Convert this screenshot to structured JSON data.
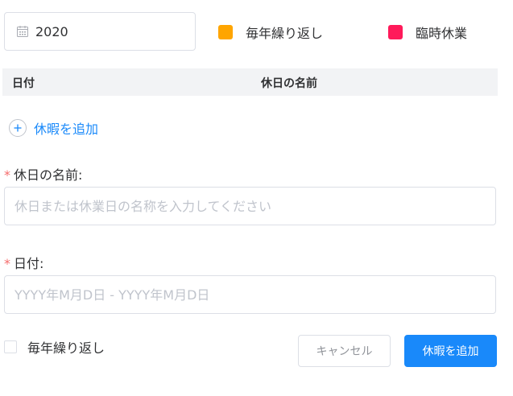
{
  "year_picker": {
    "value": "2020",
    "icon": "calendar-icon"
  },
  "legend": [
    {
      "label": "毎年繰り返し",
      "color": "#ffa500"
    },
    {
      "label": "臨時休業",
      "color": "#ff1a5a"
    }
  ],
  "table": {
    "columns": [
      "日付",
      "休日の名前"
    ]
  },
  "add_link": {
    "label": "休暇を追加",
    "icon": "plus-circle-icon"
  },
  "form": {
    "name": {
      "required_mark": "*",
      "label": "休日の名前:",
      "placeholder": "休日または休業日の名称を入力してください",
      "value": ""
    },
    "date": {
      "required_mark": "*",
      "label": "日付:",
      "placeholder": "YYYY年M月D日 - YYYY年M月D日",
      "value": ""
    },
    "repeat": {
      "label": "毎年繰り返し",
      "checked": false
    }
  },
  "buttons": {
    "cancel": "キャンセル",
    "submit": "休暇を追加"
  },
  "colors": {
    "accent": "#1989fa",
    "required": "#f56c6c"
  }
}
